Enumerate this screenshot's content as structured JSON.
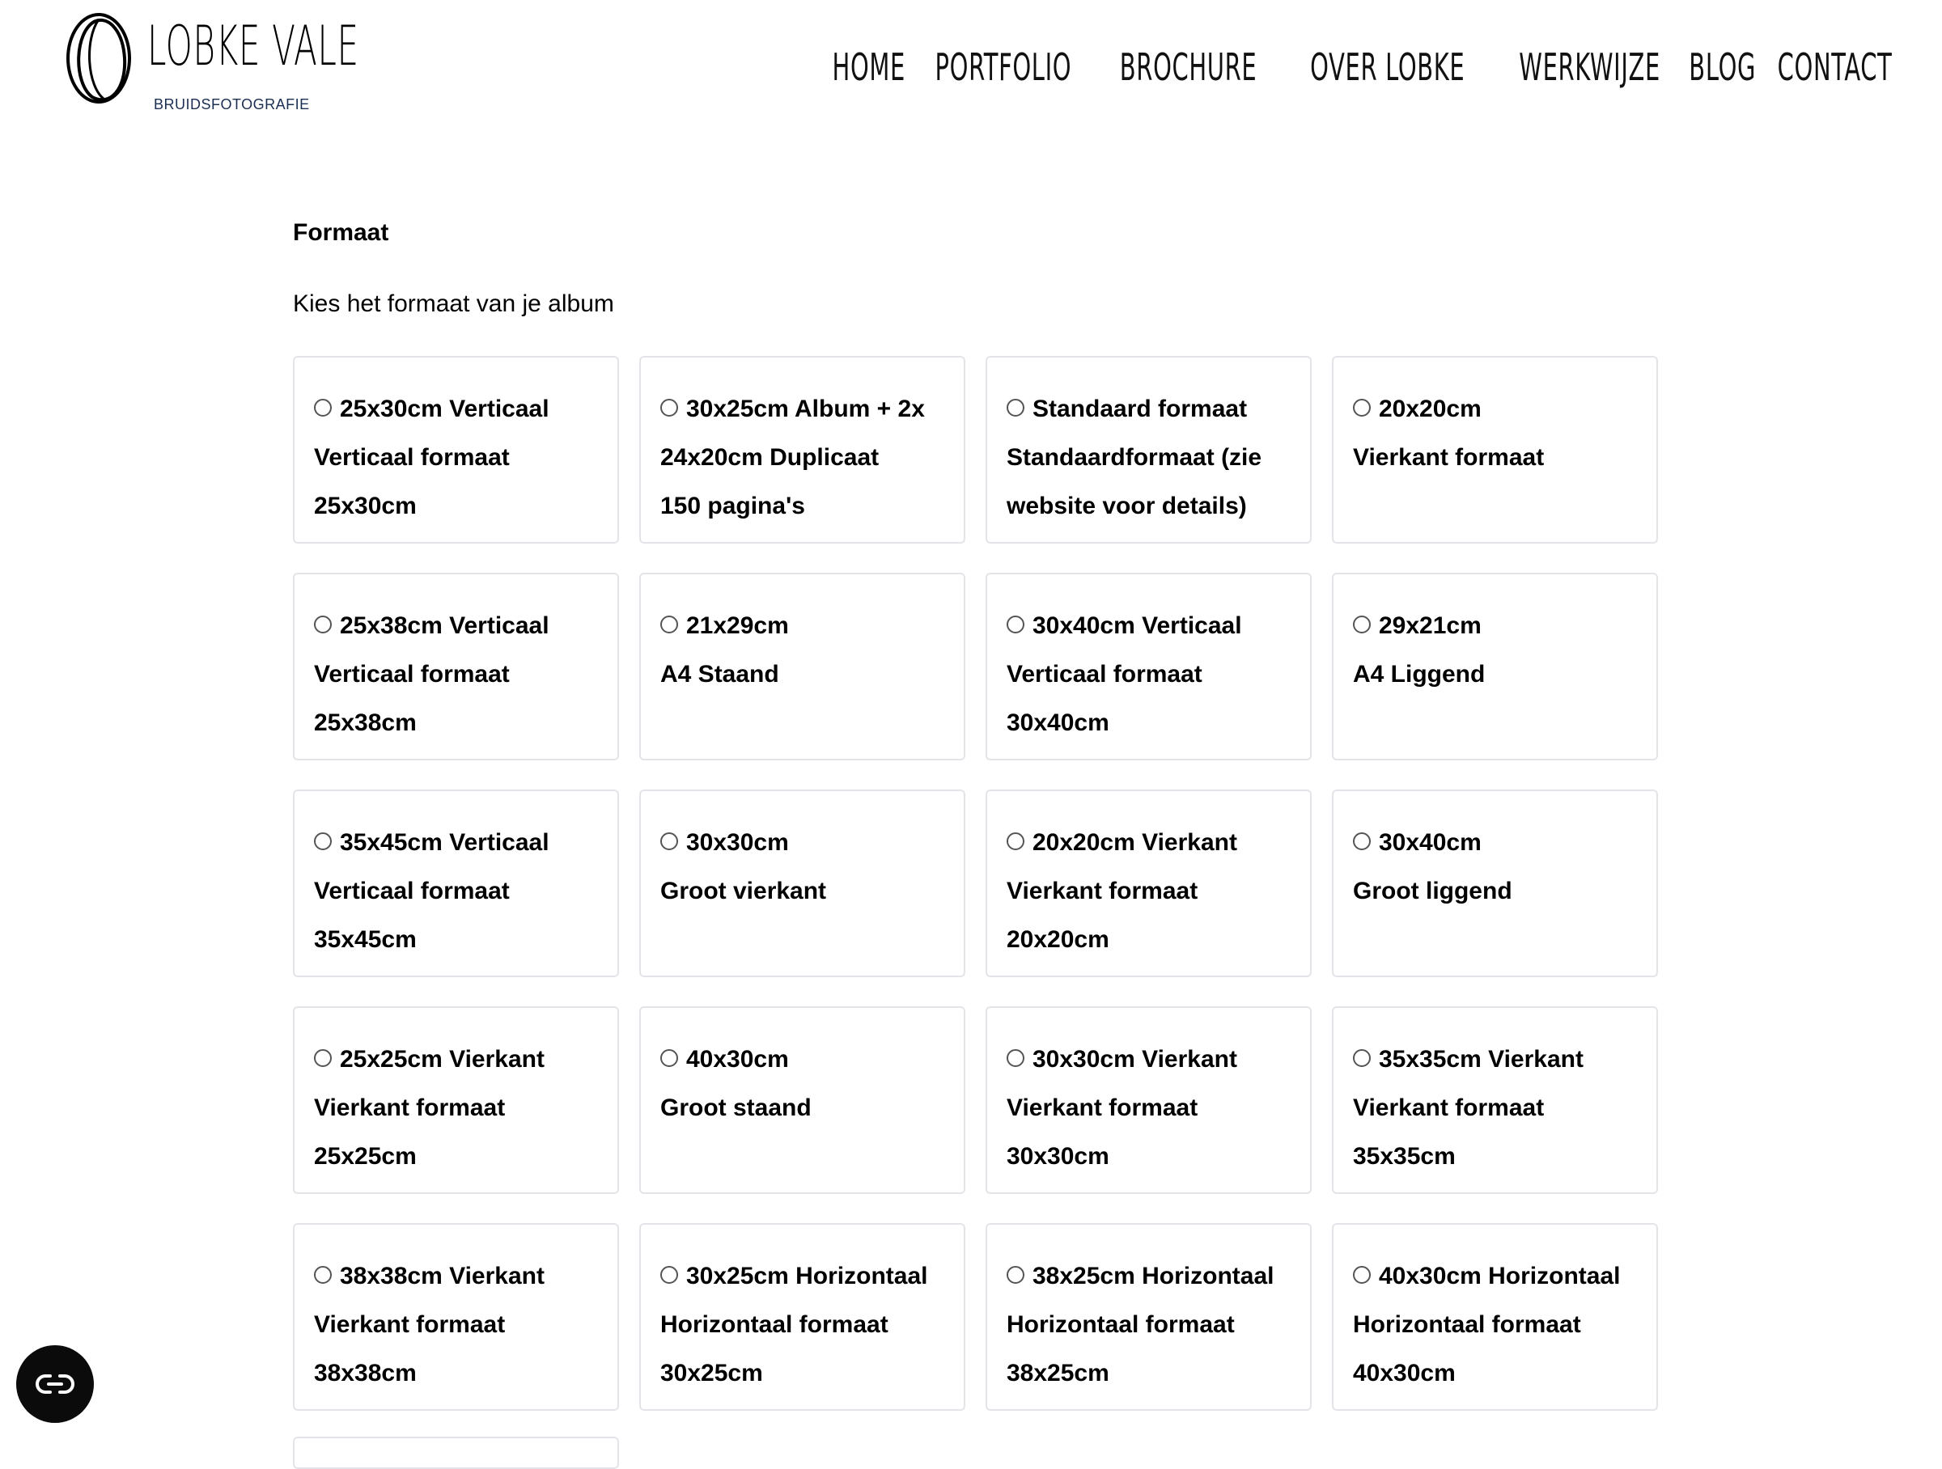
{
  "brand": {
    "name": "LOBKE VALE",
    "tagline": "BRUIDSFOTOGRAFIE"
  },
  "nav": {
    "items": [
      {
        "label": "HOME"
      },
      {
        "label": "PORTFOLIO"
      },
      {
        "label": "BROCHURE"
      },
      {
        "label": "OVER LOBKE"
      },
      {
        "label": "WERKWIJZE"
      },
      {
        "label": "BLOG"
      },
      {
        "label": "CONTACT"
      }
    ]
  },
  "section": {
    "title": "Formaat",
    "description": "Kies het formaat van je album"
  },
  "options": [
    {
      "line1": "25x30cm Verticaal",
      "line2": "Verticaal formaat",
      "line3": "25x30cm",
      "selected": false
    },
    {
      "line1": "30x25cm Album + 2x",
      "line2": "24x20cm Duplicaat",
      "line3": "150 pagina's",
      "selected": false
    },
    {
      "line1": "Standaard formaat",
      "line2": "Standaardformaat (zie",
      "line3": "website voor details)",
      "selected": false
    },
    {
      "line1": "20x20cm",
      "line2": "Vierkant formaat",
      "line3": "",
      "selected": false
    },
    {
      "line1": "25x38cm Verticaal",
      "line2": "Verticaal formaat",
      "line3": "25x38cm",
      "selected": false
    },
    {
      "line1": "21x29cm",
      "line2": "A4 Staand",
      "line3": "",
      "selected": false
    },
    {
      "line1": "30x40cm Verticaal",
      "line2": "Verticaal formaat",
      "line3": "30x40cm",
      "selected": false
    },
    {
      "line1": "29x21cm",
      "line2": "A4 Liggend",
      "line3": "",
      "selected": false
    },
    {
      "line1": "35x45cm Verticaal",
      "line2": "Verticaal formaat",
      "line3": "35x45cm",
      "selected": false
    },
    {
      "line1": "30x30cm",
      "line2": "Groot vierkant",
      "line3": "",
      "selected": false
    },
    {
      "line1": "20x20cm Vierkant",
      "line2": "Vierkant formaat",
      "line3": "20x20cm",
      "selected": false
    },
    {
      "line1": "30x40cm",
      "line2": "Groot liggend",
      "line3": "",
      "selected": false
    },
    {
      "line1": "25x25cm Vierkant",
      "line2": "Vierkant formaat",
      "line3": "25x25cm",
      "selected": false
    },
    {
      "line1": "40x30cm",
      "line2": "Groot staand",
      "line3": "",
      "selected": false
    },
    {
      "line1": "30x30cm Vierkant",
      "line2": "Vierkant formaat",
      "line3": "30x30cm",
      "selected": false
    },
    {
      "line1": "35x35cm Vierkant",
      "line2": "Vierkant formaat",
      "line3": "35x35cm",
      "selected": false
    },
    {
      "line1": "38x38cm Vierkant",
      "line2": "Vierkant formaat",
      "line3": "38x38cm",
      "selected": false
    },
    {
      "line1": "30x25cm Horizontaal",
      "line2": "Horizontaal formaat",
      "line3": "30x25cm",
      "selected": false
    },
    {
      "line1": "38x25cm Horizontaal",
      "line2": "Horizontaal formaat",
      "line3": "38x25cm",
      "selected": false
    },
    {
      "line1": "40x30cm Horizontaal",
      "line2": "Horizontaal formaat",
      "line3": "40x30cm",
      "selected": false
    }
  ],
  "accessibility": {
    "icon": "accessibility-toggle-icon"
  },
  "colors": {
    "card_border": "#e2e4e8",
    "tagline": "#1b2f52",
    "text": "#000000"
  }
}
